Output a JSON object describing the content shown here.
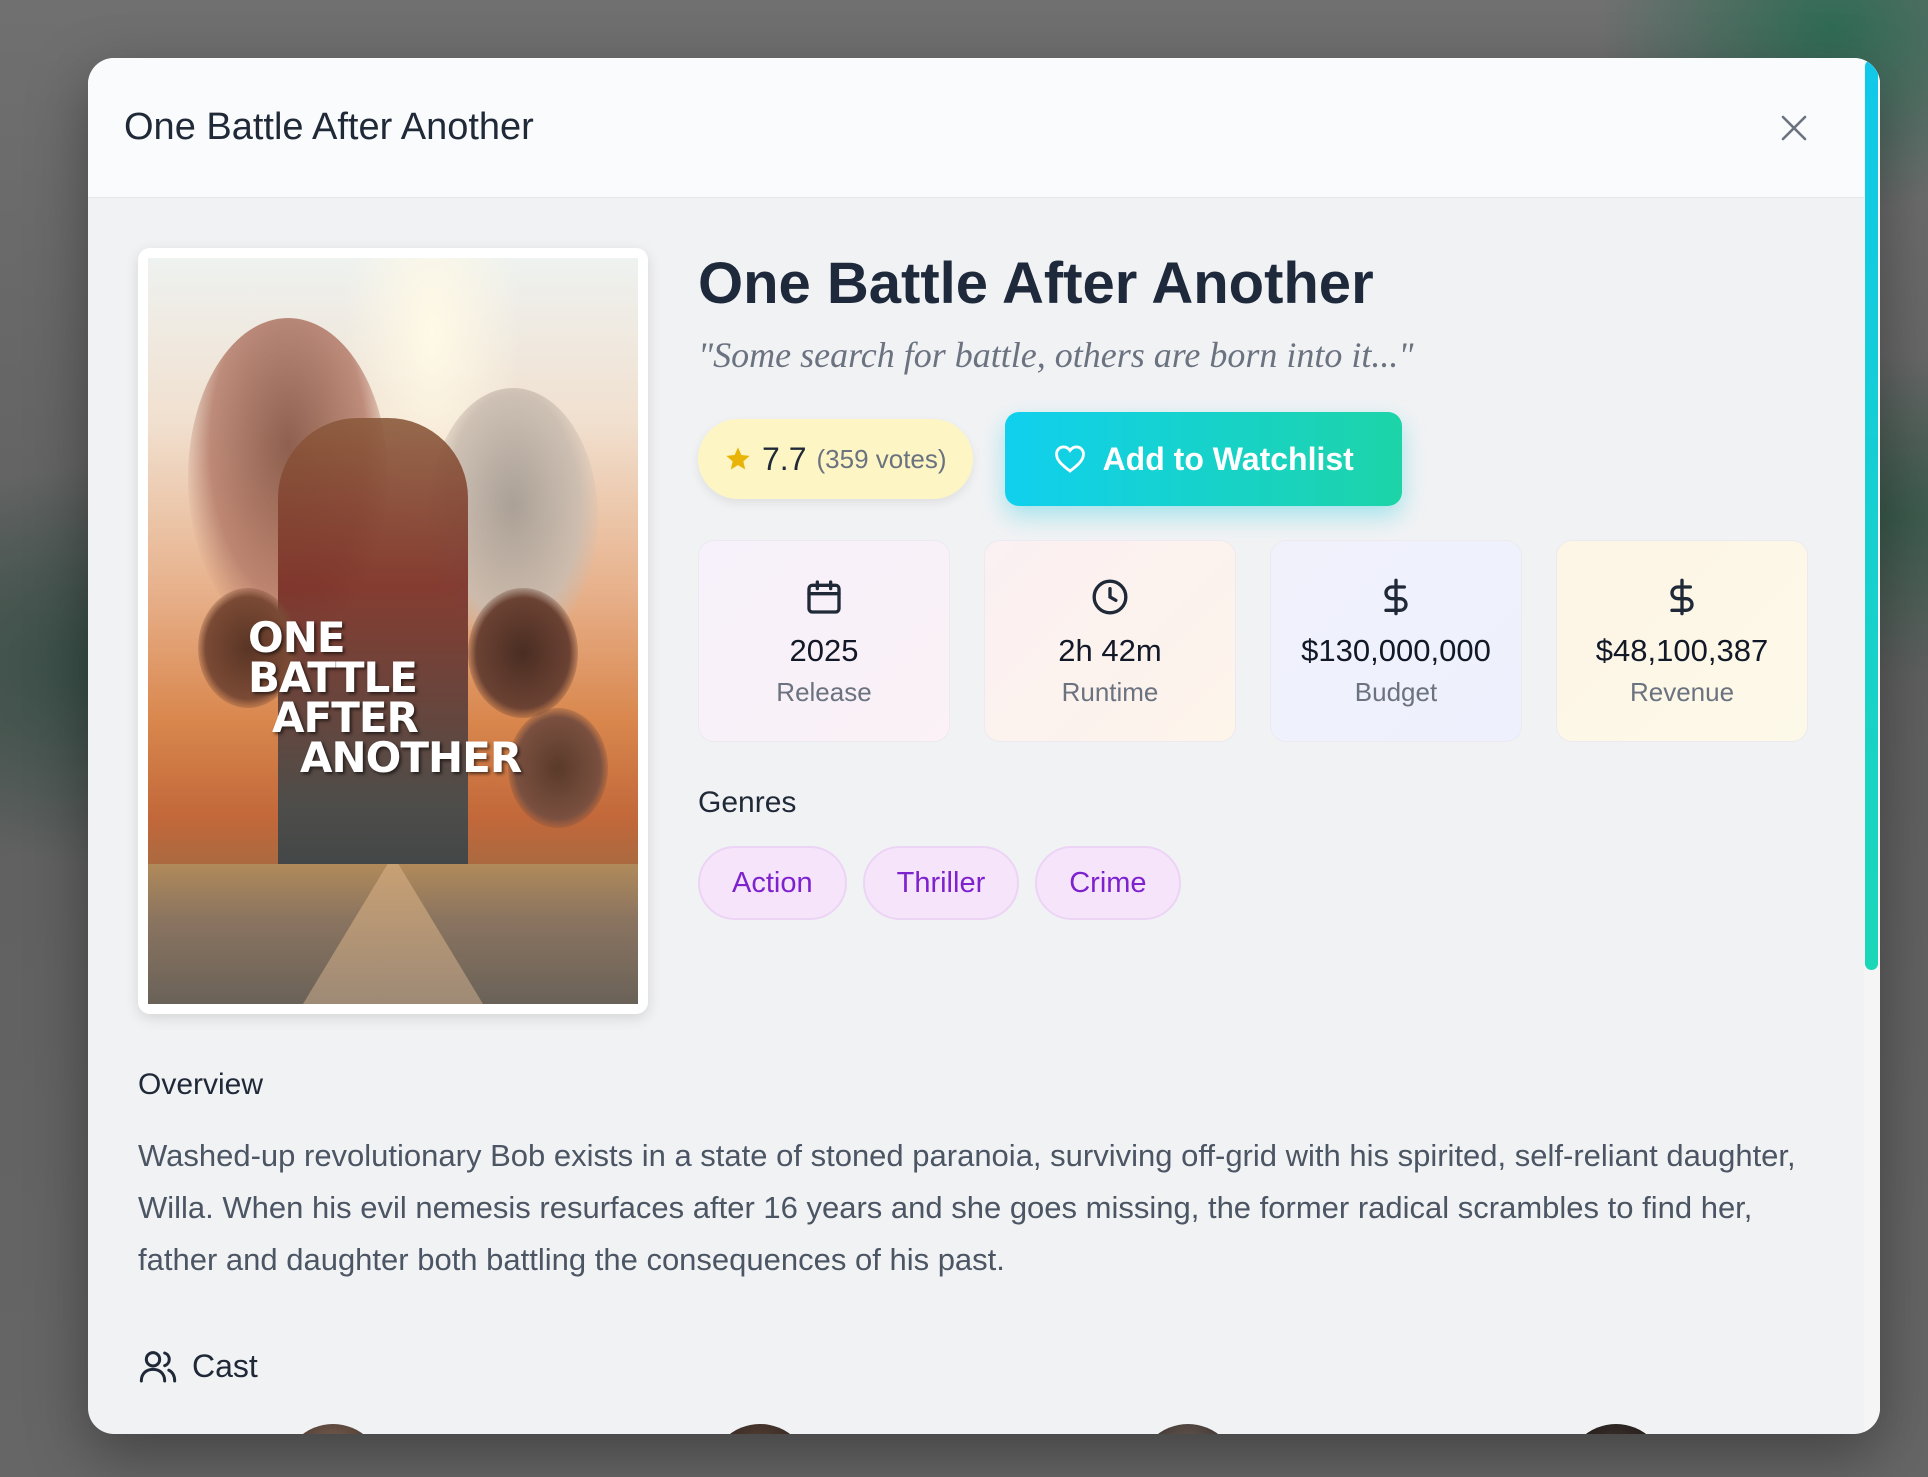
{
  "modal": {
    "header_title": "One Battle After Another"
  },
  "movie": {
    "title": "One Battle After Another",
    "tagline": "\"Some search for battle, others are born into it...\"",
    "poster_title_lines": [
      "ONE BATTLE",
      "AFTER",
      "ANOTHER"
    ],
    "rating": "7.7",
    "votes": "(359 votes)",
    "watchlist_label": "Add to Watchlist",
    "stats": [
      {
        "icon": "calendar-icon",
        "value": "2025",
        "label": "Release"
      },
      {
        "icon": "clock-icon",
        "value": "2h 42m",
        "label": "Runtime"
      },
      {
        "icon": "dollar-icon",
        "value": "$130,000,000",
        "label": "Budget"
      },
      {
        "icon": "dollar-icon",
        "value": "$48,100,387",
        "label": "Revenue"
      }
    ],
    "genres_heading": "Genres",
    "genres": [
      "Action",
      "Thriller",
      "Crime"
    ],
    "overview_heading": "Overview",
    "overview": "Washed-up revolutionary Bob exists in a state of stoned paranoia, surviving off-grid with his spirited, self-reliant daughter, Willa. When his evil nemesis resurfaces after 16 years and she goes missing, the former radical scrambles to find her, father and daughter both battling the consequences of his past.",
    "cast_heading": "Cast"
  },
  "colors": {
    "accent_start": "#10d0ee",
    "accent_end": "#1dd4a8",
    "genre_text": "#7e22ce",
    "star": "#eab308"
  }
}
